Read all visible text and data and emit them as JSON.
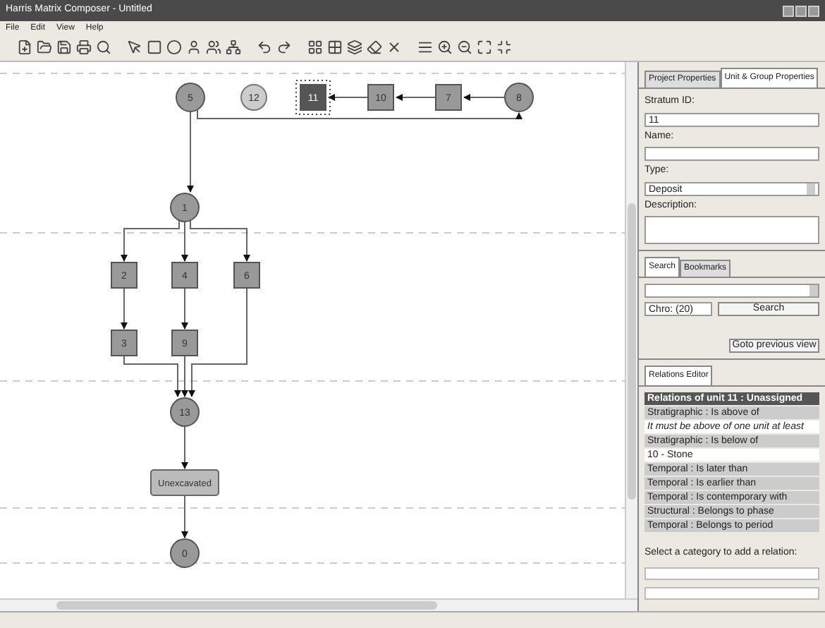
{
  "window": {
    "title": "Harris Matrix Composer - Untitled"
  },
  "menu": [
    "File",
    "Edit",
    "View",
    "Help"
  ],
  "diagram": {
    "nodes": [
      {
        "label": "5",
        "kind": "circle",
        "selected": false
      },
      {
        "label": "12",
        "kind": "open-circle",
        "selected": false
      },
      {
        "label": "11",
        "kind": "square",
        "selected": true
      },
      {
        "label": "10",
        "kind": "square",
        "selected": false
      },
      {
        "label": "7",
        "kind": "square",
        "selected": false
      },
      {
        "label": "8",
        "kind": "circle",
        "selected": false
      },
      {
        "label": "1",
        "kind": "circle",
        "selected": false
      },
      {
        "label": "2",
        "kind": "square",
        "selected": false
      },
      {
        "label": "4",
        "kind": "square",
        "selected": false
      },
      {
        "label": "6",
        "kind": "square",
        "selected": false
      },
      {
        "label": "3",
        "kind": "square",
        "selected": false
      },
      {
        "label": "9",
        "kind": "square",
        "selected": false
      },
      {
        "label": "13",
        "kind": "circle",
        "selected": false
      },
      {
        "label": "Unexcavated",
        "kind": "box",
        "selected": false
      },
      {
        "label": "0",
        "kind": "circle",
        "selected": false
      }
    ]
  },
  "properties_panel": {
    "tabs": [
      {
        "label": "Project Properties",
        "selected": false
      },
      {
        "label": "Unit & Group Properties",
        "selected": true
      }
    ],
    "stratum_id_label": "Stratum ID:",
    "stratum_id": "11",
    "name_label": "Name:",
    "type_label": "Type:",
    "type": "Deposit",
    "description_label": "Description:"
  },
  "search_panel": {
    "tabs": [
      {
        "label": "Search",
        "selected": true
      },
      {
        "label": "Bookmarks",
        "selected": false
      }
    ],
    "scope": "Chro: (20)",
    "search_button": "Search",
    "previous_button": "Goto previous view"
  },
  "relations_editor": {
    "tabs": [
      {
        "label": "Relations Editor",
        "selected": true
      }
    ],
    "items": [
      {
        "text": "Relations of unit 11 : Unassigned",
        "kind": "header"
      },
      {
        "text": "Stratigraphic : Is above of",
        "kind": "category"
      },
      {
        "text": "It must be above of one unit at least",
        "kind": "hint"
      },
      {
        "text": "Stratigraphic : Is below of",
        "kind": "category"
      },
      {
        "text": "10 - Stone",
        "kind": "entry"
      },
      {
        "text": "Temporal : Is later than",
        "kind": "category"
      },
      {
        "text": "Temporal : Is earlier than",
        "kind": "category"
      },
      {
        "text": "Temporal : Is contemporary with",
        "kind": "category"
      },
      {
        "text": "Structural : Belongs to phase",
        "kind": "category"
      },
      {
        "text": "Temporal : Belongs to period",
        "kind": "category"
      }
    ],
    "add_label": "Select a category to add a relation:"
  }
}
